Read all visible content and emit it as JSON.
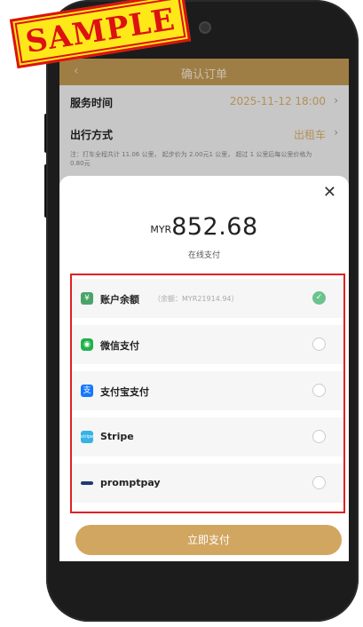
{
  "stamp": {
    "text": "SAMPLE"
  },
  "nav": {
    "back_icon": "chevron-left-icon",
    "title": "确认订单"
  },
  "order": {
    "service_time_label": "服务时间",
    "service_time_value": "2025-11-12 18:00",
    "travel_mode_label": "出行方式",
    "travel_mode_value": "出租车",
    "note": "注：打车全程共计 11.06 公里， 起步价为 2.00元1 公里， 超过 1 公里后每公里价格为 0.80元"
  },
  "sheet": {
    "close_icon": "close-icon",
    "currency": "MYR",
    "amount": "852.68",
    "subtitle": "在线支付",
    "methods": [
      {
        "name": "账户余额",
        "extra": "（余额：MYR21914.94）",
        "icon": "wallet-icon",
        "icon_color": "#4aa46a",
        "selected": true
      },
      {
        "name": "微信支付",
        "extra": "",
        "icon": "wechat-icon",
        "icon_color": "#22b14c",
        "selected": false
      },
      {
        "name": "支付宝支付",
        "extra": "",
        "icon": "alipay-icon",
        "icon_color": "#1677ff",
        "selected": false
      },
      {
        "name": "Stripe",
        "extra": "",
        "icon": "stripe-icon",
        "icon_color": "#36b3e6",
        "selected": false
      },
      {
        "name": "promptpay",
        "extra": "",
        "icon": "promptpay-icon",
        "icon_color": "#1f3b6f",
        "selected": false
      }
    ],
    "pay_button": "立即支付"
  },
  "colors": {
    "accent": "#d1a660",
    "highlight_border": "#e02020",
    "selected": "#6cc38d"
  }
}
